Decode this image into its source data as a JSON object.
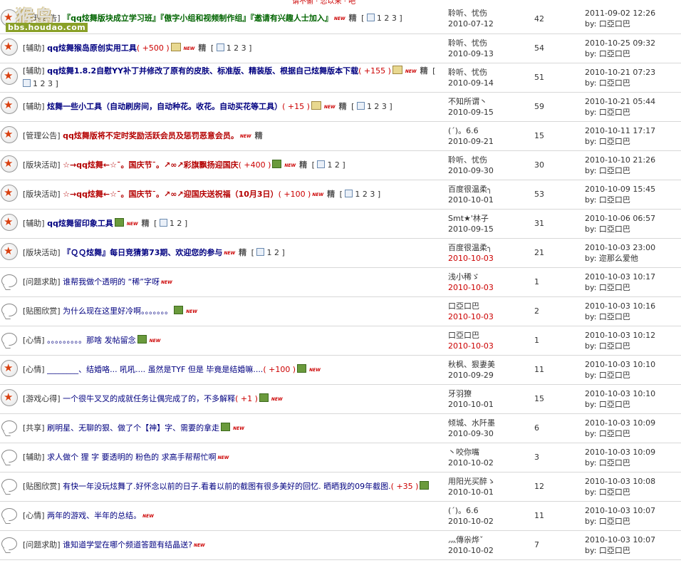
{
  "top_strip_text": "请不偷 · 恋以来 · 吧",
  "watermark": {
    "logo": "猴岛",
    "url": "bbs.houdao.com"
  },
  "threads": [
    {
      "icon": "star-icon",
      "type": "[管理公告]",
      "title": "『qq炫舞版块成立学习班』『傲字小组和视频制作组』『邀请有兴趣人士加入』",
      "title_style": "bold-green",
      "plus": "",
      "has_new": true,
      "has_jing": true,
      "has_img": false,
      "has_sticky": false,
      "pages": "1 2 3",
      "author": "聆听、忧伤",
      "adate": "2010-07-12",
      "adate_red": false,
      "replies": "42",
      "ltime": "2011-09-02 12:26",
      "lby": "by: 口亞口巴"
    },
    {
      "icon": "star-icon",
      "type": "[辅助]",
      "title": "qq炫舞猴岛原创实用工具",
      "title_style": "bold-blue",
      "plus": "( +500 )",
      "has_new": true,
      "has_jing": true,
      "has_img": false,
      "has_sticky": true,
      "pages": "1 2 3",
      "author": "聆听、忧伤",
      "adate": "2010-09-13",
      "adate_red": false,
      "replies": "54",
      "ltime": "2010-10-25 09:32",
      "lby": "by: 口亞口巴"
    },
    {
      "icon": "star-icon",
      "type": "[辅助]",
      "title": "qq炫舞1.8.2自慰YY补丁并修改了原有的皮肤、标准版、精装版、根据自己炫舞版本下载",
      "title_style": "bold-blue",
      "plus": "( +155 )",
      "has_new": true,
      "has_jing": true,
      "has_img": false,
      "has_sticky": true,
      "pages": "1 2 3",
      "author": "聆听、忧伤",
      "adate": "2010-09-14",
      "adate_red": false,
      "replies": "51",
      "ltime": "2010-10-21 07:23",
      "lby": "by: 口亞口巴"
    },
    {
      "icon": "star-icon",
      "type": "[辅助]",
      "title": "炫舞一些小工具（自动刷房间，自动种花。收花。自动买花等工具）",
      "title_style": "bold-blue",
      "plus": "( +15 )",
      "has_new": true,
      "has_jing": true,
      "has_img": false,
      "has_sticky": true,
      "pages": "1 2 3",
      "author": "不知所谓丶",
      "adate": "2010-09-15",
      "adate_red": false,
      "replies": "59",
      "ltime": "2010-10-21 05:44",
      "lby": "by: 口亞口巴"
    },
    {
      "icon": "star-icon",
      "type": "[管理公告]",
      "title": "qq炫舞版将不定时奖励活跃会员及惩罚恶意会员。",
      "title_style": "bold-red",
      "plus": "",
      "has_new": true,
      "has_jing": true,
      "has_img": false,
      "has_sticky": false,
      "pages": "",
      "author": "(ˊ)。6.6",
      "adate": "2010-09-21",
      "adate_red": false,
      "replies": "15",
      "ltime": "2010-10-11 17:17",
      "lby": "by: 口亞口巴"
    },
    {
      "icon": "star-icon",
      "type": "[版块活动]",
      "title": "☆→qq炫舞←☆¯。国庆节¯。↗∞↗彩旗飘扬迎国庆",
      "title_style": "bold-red",
      "plus": "( +400 )",
      "has_new": true,
      "has_jing": true,
      "has_img": true,
      "has_sticky": false,
      "pages": "1 2",
      "author": "聆听、忧伤",
      "adate": "2010-09-30",
      "adate_red": false,
      "replies": "30",
      "ltime": "2010-10-10 21:26",
      "lby": "by: 口亞口巴"
    },
    {
      "icon": "star-icon",
      "type": "[版块活动]",
      "title": "☆→qq炫舞←☆¯。国庆节¯。↗∞↗迎国庆送祝福（10月3日）",
      "title_style": "bold-red",
      "plus": "( +100 )",
      "has_new": true,
      "has_jing": true,
      "has_img": false,
      "has_sticky": false,
      "pages": "1 2 3",
      "author": "百度很温柔╮",
      "adate": "2010-10-01",
      "adate_red": false,
      "replies": "53",
      "ltime": "2010-10-09 15:45",
      "lby": "by: 口亞口巴"
    },
    {
      "icon": "star-icon",
      "type": "[辅助]",
      "title": "qq炫舞留印象工具",
      "title_style": "bold-blue",
      "plus": "",
      "has_new": true,
      "has_jing": true,
      "has_img": true,
      "has_sticky": false,
      "pages": "1 2",
      "author": "Smt★'林子",
      "adate": "2010-09-15",
      "adate_red": false,
      "replies": "31",
      "ltime": "2010-10-06 06:57",
      "lby": "by: 口亞口巴"
    },
    {
      "icon": "star-icon",
      "type": "[版块活动]",
      "title": "『ＱＱ炫舞』每日竞猜第73期、欢迎您的参与",
      "title_style": "bold-blue",
      "plus": "",
      "has_new": true,
      "has_jing": true,
      "has_img": false,
      "has_sticky": false,
      "pages": "1 2",
      "author": "百度很温柔╮",
      "adate": "2010-10-03",
      "adate_red": true,
      "replies": "21",
      "ltime": "2010-10-03 23:00",
      "lby": "by: 迩那么爱他"
    },
    {
      "icon": "bubble-icon",
      "type": "[问题求助]",
      "title": "谁帮我做个透明的  “稀”字呀",
      "title_style": "lnk",
      "plus": "",
      "has_new": true,
      "has_jing": false,
      "has_img": false,
      "has_sticky": false,
      "pages": "",
      "author": "浅小稀ゞ",
      "adate": "2010-10-03",
      "adate_red": true,
      "replies": "1",
      "ltime": "2010-10-03 10:17",
      "lby": "by: 口亞口巴"
    },
    {
      "icon": "bubble-icon",
      "type": "[贴图欣赏]",
      "title": "为什么现在这里好冷啊。。。。。。。",
      "title_style": "lnk",
      "plus": "",
      "has_new": true,
      "has_jing": false,
      "has_img": true,
      "has_sticky": false,
      "pages": "",
      "author": "口亞口巴",
      "adate": "2010-10-03",
      "adate_red": true,
      "replies": "2",
      "ltime": "2010-10-03 10:16",
      "lby": "by: 口亞口巴"
    },
    {
      "icon": "bubble-icon",
      "type": "[心情]",
      "title": "。。。。。。。。。那啥 发帖留念",
      "title_style": "lnk",
      "plus": "",
      "has_new": true,
      "has_jing": false,
      "has_img": true,
      "has_sticky": false,
      "pages": "",
      "author": "口亞口巴",
      "adate": "2010-10-03",
      "adate_red": true,
      "replies": "1",
      "ltime": "2010-10-03 10:12",
      "lby": "by: 口亞口巴"
    },
    {
      "icon": "star-icon",
      "type": "[心情]",
      "title": "________、结婚咯...  吼吼....  虽然是TYF  但是  毕竟是结婚嘛....",
      "title_style": "lnk",
      "plus": "( +100 )",
      "has_new": true,
      "has_jing": false,
      "has_img": true,
      "has_sticky": false,
      "pages": "",
      "author": "秋枫、狠妻美",
      "adate": "2010-09-29",
      "adate_red": false,
      "replies": "11",
      "ltime": "2010-10-03 10:10",
      "lby": "by: 口亞口巴"
    },
    {
      "icon": "star-icon",
      "type": "[游戏心得]",
      "title": "一个很牛叉叉的成就任务让偶完成了的，不多解释",
      "title_style": "lnk",
      "plus": "( +1 )",
      "has_new": true,
      "has_jing": false,
      "has_img": true,
      "has_sticky": false,
      "pages": "",
      "author": "牙羽獠",
      "adate": "2010-10-01",
      "adate_red": false,
      "replies": "15",
      "ltime": "2010-10-03 10:10",
      "lby": "by: 口亞口巴"
    },
    {
      "icon": "bubble-icon",
      "type": "[共享]",
      "title": "刷明星、无聊的狠、做了个【神】字、需要的拿走",
      "title_style": "lnk",
      "plus": "",
      "has_new": true,
      "has_jing": false,
      "has_img": true,
      "has_sticky": false,
      "pages": "",
      "author": "倾城、水阡墨",
      "adate": "2010-09-30",
      "adate_red": false,
      "replies": "6",
      "ltime": "2010-10-03 10:09",
      "lby": "by: 口亞口巴"
    },
    {
      "icon": "bubble-icon",
      "type": "[辅助]",
      "title": "求人做个  狸  字  要透明的  粉色的  求高手帮帮忙啊",
      "title_style": "lnk",
      "plus": "",
      "has_new": true,
      "has_jing": false,
      "has_img": false,
      "has_sticky": false,
      "pages": "",
      "author": "丶咬你嘴",
      "adate": "2010-10-02",
      "adate_red": false,
      "replies": "3",
      "ltime": "2010-10-03 10:09",
      "lby": "by: 口亞口巴"
    },
    {
      "icon": "bubble-icon",
      "type": "[贴图欣赏]",
      "title": "有快一年没玩炫舞了.好怀念以前的日子.看着以前的截图有很多美好的回忆. 晒晒我的09年截图.",
      "title_style": "lnk",
      "plus": "( +35 )",
      "has_new": false,
      "has_jing": false,
      "has_img": true,
      "has_sticky": false,
      "pages": "",
      "author": "用阳光买醉ゝ",
      "adate": "2010-10-01",
      "adate_red": false,
      "replies": "12",
      "ltime": "2010-10-03 10:08",
      "lby": "by: 口亞口巴"
    },
    {
      "icon": "bubble-icon",
      "type": "[心情]",
      "title": "两年的游戏、半年的总结。",
      "title_style": "lnk",
      "plus": "",
      "has_new": true,
      "has_jing": false,
      "has_img": false,
      "has_sticky": false,
      "pages": "",
      "author": "(ˊ)。6.6",
      "adate": "2010-10-02",
      "adate_red": false,
      "replies": "11",
      "ltime": "2010-10-03 10:07",
      "lby": "by: 口亞口巴"
    },
    {
      "icon": "bubble-icon",
      "type": "[问题求助]",
      "title": "谁知道学堂在哪个频道答题有结晶送?",
      "title_style": "lnk",
      "plus": "",
      "has_new": true,
      "has_jing": false,
      "has_img": false,
      "has_sticky": false,
      "pages": "",
      "author": "灬傳尜烨ˇ",
      "adate": "2010-10-02",
      "adate_red": false,
      "replies": "7",
      "ltime": "2010-10-03 10:07",
      "lby": "by: 口亞口巴"
    }
  ]
}
